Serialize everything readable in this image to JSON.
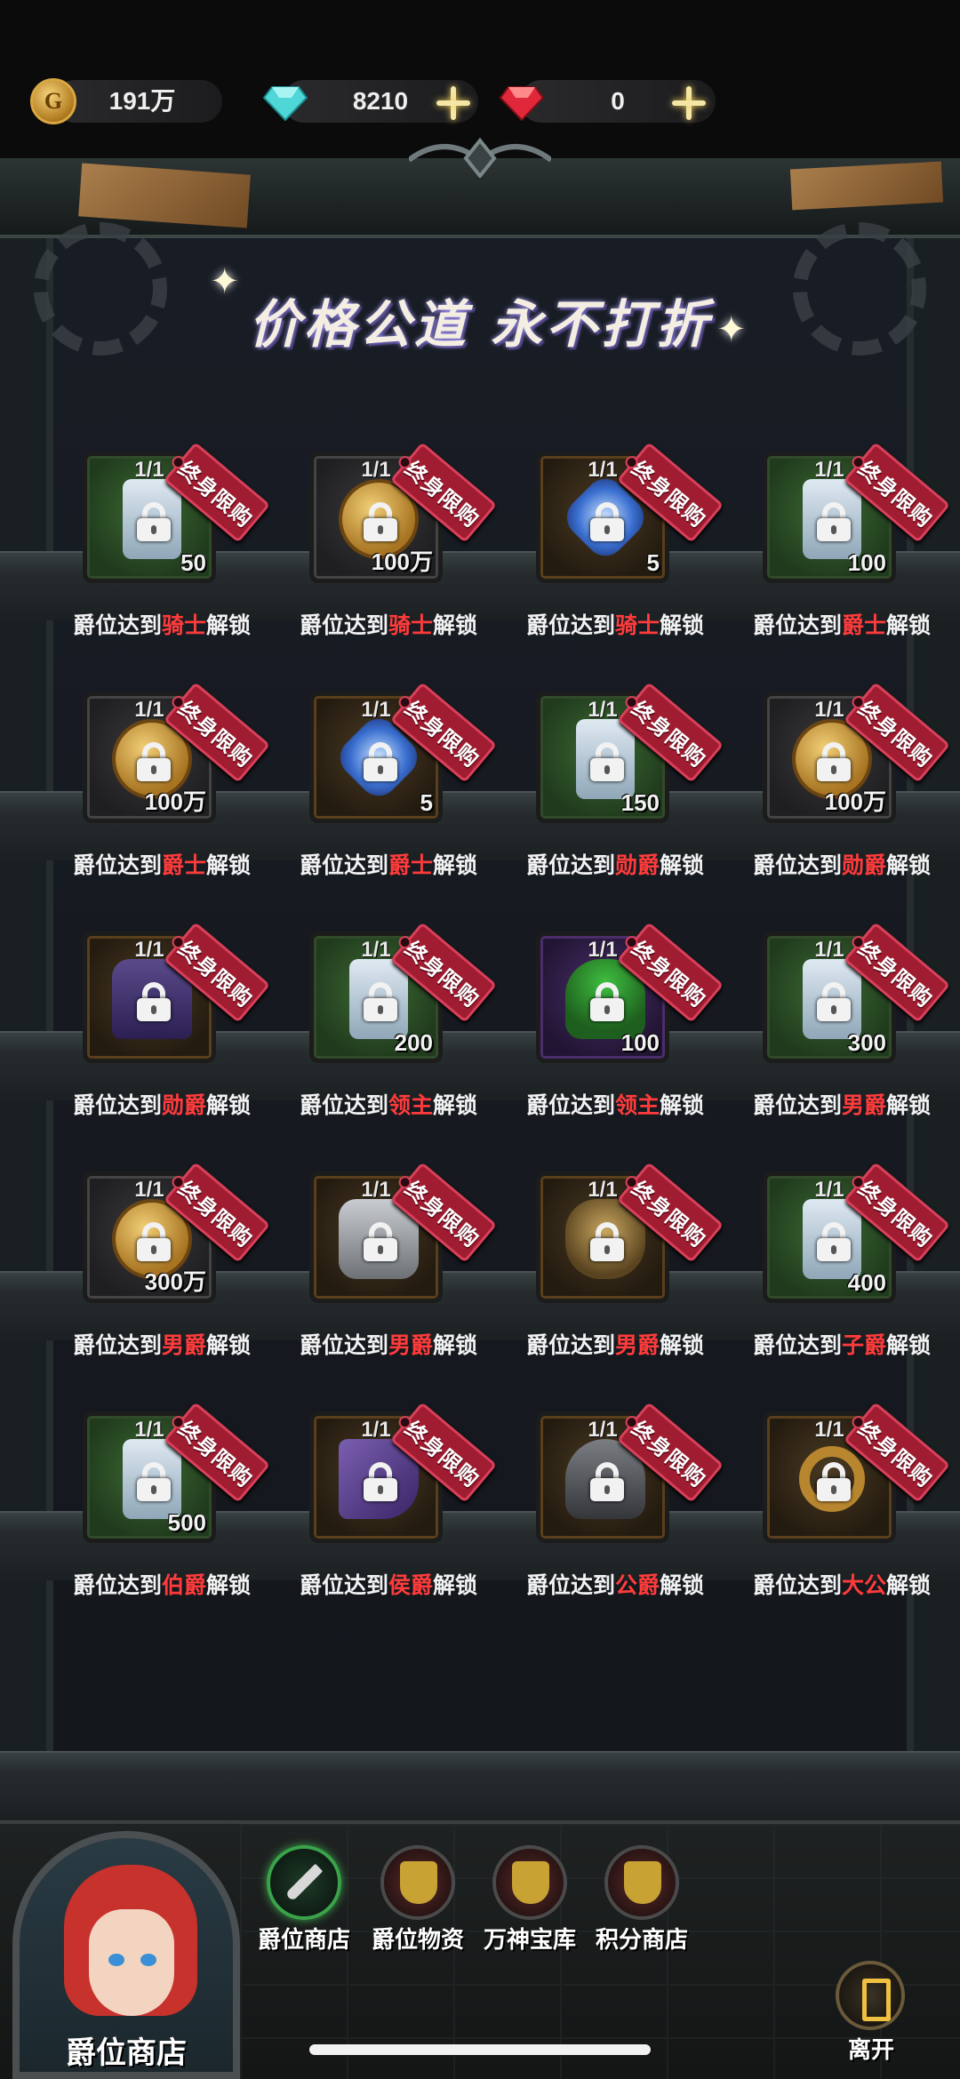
{
  "currency": {
    "gold": "191万",
    "diamond": "8210",
    "ruby": "0"
  },
  "title": "价格公道 永不打折",
  "tag_label": "终身限购",
  "unlock_prefix": "爵位达到",
  "unlock_suffix": "解锁",
  "items": [
    {
      "qty": "1/1",
      "amount": "50",
      "rank": "骑士",
      "icon": "scroll-icon",
      "bg": "green"
    },
    {
      "qty": "1/1",
      "amount": "100万",
      "rank": "骑士",
      "icon": "coin-icon",
      "bg": "gray"
    },
    {
      "qty": "1/1",
      "amount": "5",
      "rank": "骑士",
      "icon": "gem-icon",
      "bg": "gold"
    },
    {
      "qty": "1/1",
      "amount": "100",
      "rank": "爵士",
      "icon": "scroll-icon",
      "bg": "green"
    },
    {
      "qty": "1/1",
      "amount": "100万",
      "rank": "爵士",
      "icon": "coin-icon",
      "bg": "gray"
    },
    {
      "qty": "1/1",
      "amount": "5",
      "rank": "爵士",
      "icon": "gem-icon",
      "bg": "gold"
    },
    {
      "qty": "1/1",
      "amount": "150",
      "rank": "勋爵",
      "icon": "scroll-icon",
      "bg": "green"
    },
    {
      "qty": "1/1",
      "amount": "100万",
      "rank": "勋爵",
      "icon": "coin-icon",
      "bg": "gray"
    },
    {
      "qty": "1/1",
      "amount": "",
      "rank": "勋爵",
      "icon": "robe-icon",
      "bg": "gold"
    },
    {
      "qty": "1/1",
      "amount": "200",
      "rank": "领主",
      "icon": "scroll-icon",
      "bg": "green"
    },
    {
      "qty": "1/1",
      "amount": "100",
      "rank": "领主",
      "icon": "hood-icon",
      "bg": "purple"
    },
    {
      "qty": "1/1",
      "amount": "300",
      "rank": "男爵",
      "icon": "scroll-icon",
      "bg": "green"
    },
    {
      "qty": "1/1",
      "amount": "300万",
      "rank": "男爵",
      "icon": "coin-icon",
      "bg": "gray"
    },
    {
      "qty": "1/1",
      "amount": "",
      "rank": "男爵",
      "icon": "armor-icon",
      "bg": "gold"
    },
    {
      "qty": "1/1",
      "amount": "",
      "rank": "男爵",
      "icon": "mask-icon",
      "bg": "gold"
    },
    {
      "qty": "1/1",
      "amount": "400",
      "rank": "子爵",
      "icon": "scroll-icon",
      "bg": "green"
    },
    {
      "qty": "1/1",
      "amount": "500",
      "rank": "伯爵",
      "icon": "scroll-icon",
      "bg": "green"
    },
    {
      "qty": "1/1",
      "amount": "",
      "rank": "侯爵",
      "icon": "boot-icon",
      "bg": "gold"
    },
    {
      "qty": "1/1",
      "amount": "",
      "rank": "公爵",
      "icon": "helm-icon",
      "bg": "gold"
    },
    {
      "qty": "1/1",
      "amount": "",
      "rank": "大公",
      "icon": "ring-icon",
      "bg": "gold"
    }
  ],
  "portrait_label": "爵位商店",
  "nav": [
    {
      "label": "爵位商店",
      "active": true
    },
    {
      "label": "爵位物资",
      "active": false
    },
    {
      "label": "万神宝库",
      "active": false
    },
    {
      "label": "积分商店",
      "active": false
    }
  ],
  "exit_label": "离开"
}
